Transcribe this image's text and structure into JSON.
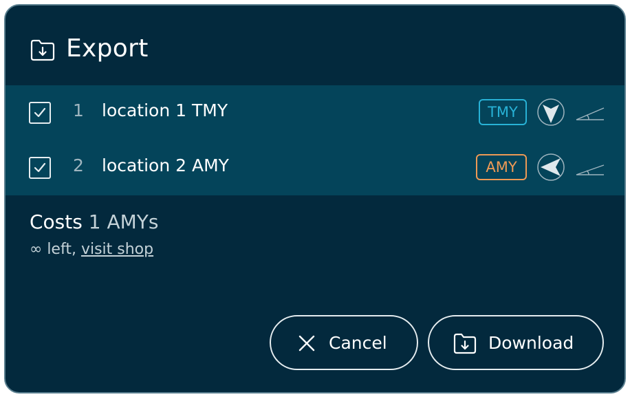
{
  "dialog": {
    "title": "Export",
    "title_icon": "folder-download-icon"
  },
  "locations": [
    {
      "checked": true,
      "number": "1",
      "name": "location 1 TMY",
      "badge": "TMY",
      "badge_color": "#28b2d6",
      "orientation_icon": "compass-south-icon",
      "tilt_icon": "tilt-angle-icon"
    },
    {
      "checked": true,
      "number": "2",
      "name": "location 2 AMY",
      "badge": "AMY",
      "badge_color": "#ef9a55",
      "orientation_icon": "compass-west-icon",
      "tilt_icon": "tilt-angle-icon"
    }
  ],
  "costs": {
    "prefix": "Costs",
    "amount": "1 AMYs",
    "remaining": "∞ left,",
    "shop_link": "visit shop"
  },
  "buttons": {
    "cancel": "Cancel",
    "cancel_icon": "close-icon",
    "download": "Download",
    "download_icon": "folder-download-icon"
  },
  "colors": {
    "background": "#03293d",
    "list_background": "#04445a",
    "tmy_accent": "#28b2d6",
    "amy_accent": "#ef9a55"
  }
}
